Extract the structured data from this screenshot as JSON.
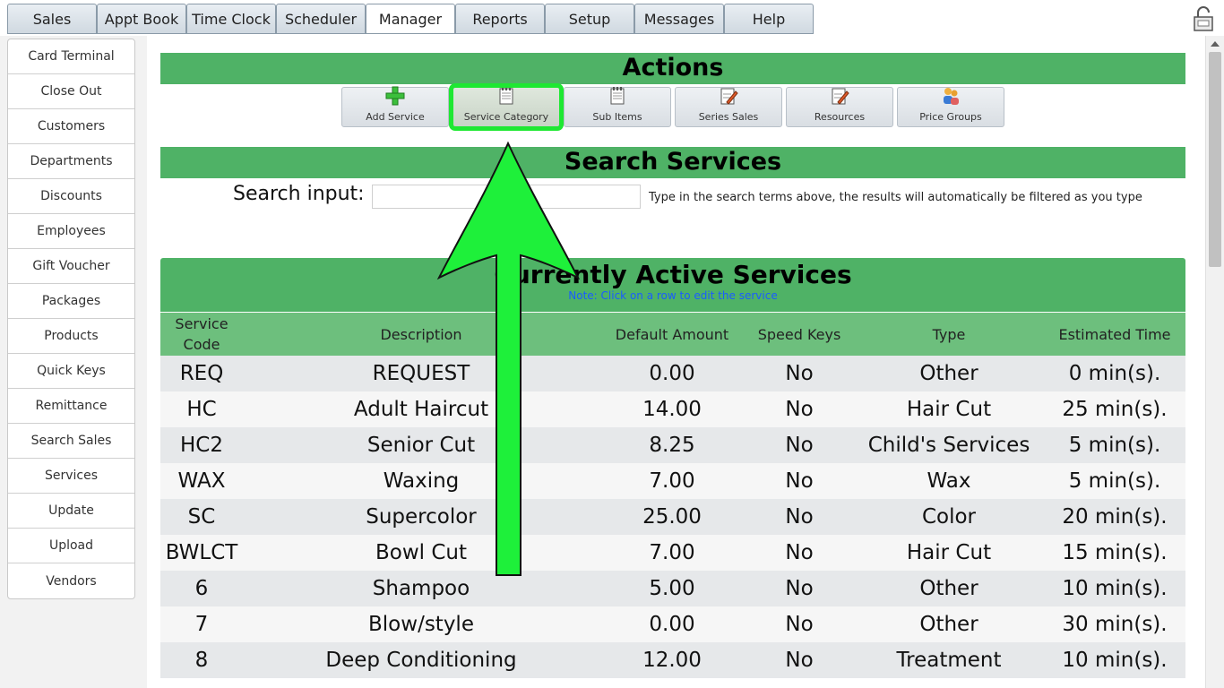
{
  "nav": {
    "tabs": [
      "Sales",
      "Appt Book",
      "Time Clock",
      "Scheduler",
      "Manager",
      "Reports",
      "Setup",
      "Messages",
      "Help"
    ],
    "active_tab": "Manager"
  },
  "sidebar": {
    "items": [
      "Card Terminal",
      "Close Out",
      "Customers",
      "Departments",
      "Discounts",
      "Employees",
      "Gift Voucher",
      "Packages",
      "Products",
      "Quick Keys",
      "Remittance",
      "Search Sales",
      "Services",
      "Update",
      "Upload",
      "Vendors"
    ]
  },
  "actions": {
    "title": "Actions",
    "buttons": [
      {
        "label": "Add Service",
        "icon": "plus-icon"
      },
      {
        "label": "Service Category",
        "icon": "notepad-icon"
      },
      {
        "label": "Sub Items",
        "icon": "notepad-icon"
      },
      {
        "label": "Series Sales",
        "icon": "pencil-note-icon"
      },
      {
        "label": "Resources",
        "icon": "pencil-note-icon"
      },
      {
        "label": "Price Groups",
        "icon": "people-icon"
      }
    ]
  },
  "search": {
    "title": "Search Services",
    "label": "Search input:",
    "value": "",
    "hint": "Type in the search terms above, the results will automatically be filtered as you type"
  },
  "services": {
    "title": "Currently Active Services",
    "note": "Note: Click on a row to edit the service",
    "columns": [
      "Service Code",
      "Description",
      "Default Amount",
      "Speed Keys",
      "Type",
      "Estimated Time"
    ],
    "rows": [
      [
        "REQ",
        "REQUEST",
        "0.00",
        "No",
        "Other",
        "0 min(s)."
      ],
      [
        "HC",
        "Adult Haircut",
        "14.00",
        "No",
        "Hair Cut",
        "25 min(s)."
      ],
      [
        "HC2",
        "Senior Cut",
        "8.25",
        "No",
        "Child's Services",
        "5 min(s)."
      ],
      [
        "WAX",
        "Waxing",
        "7.00",
        "No",
        "Wax",
        "5 min(s)."
      ],
      [
        "SC",
        "Supercolor",
        "25.00",
        "No",
        "Color",
        "20 min(s)."
      ],
      [
        "BWLCT",
        "Bowl Cut",
        "7.00",
        "No",
        "Hair Cut",
        "15 min(s)."
      ],
      [
        "6",
        "Shampoo",
        "5.00",
        "No",
        "Other",
        "10 min(s)."
      ],
      [
        "7",
        "Blow/style",
        "0.00",
        "No",
        "Other",
        "30 min(s)."
      ],
      [
        "8",
        "Deep Conditioning",
        "12.00",
        "No",
        "Treatment",
        "10 min(s)."
      ]
    ]
  },
  "colors": {
    "header_green": "#4fb266",
    "column_header_green": "#6dbf7d",
    "highlight": "#1ee832"
  }
}
